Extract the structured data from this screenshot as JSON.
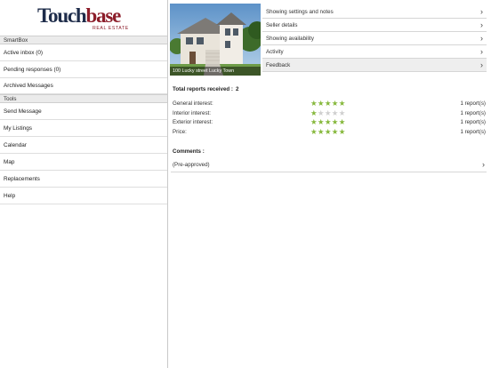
{
  "brand": {
    "logo_touch": "Touch",
    "logo_base": "base",
    "logo_sub": "REAL ESTATE"
  },
  "sidebar": {
    "sections": [
      {
        "header": "SmartBox",
        "items": [
          "Active inbox (0)",
          "Pending responses (0)",
          "Archived Messages"
        ]
      },
      {
        "header": "Tools",
        "items": [
          "Send Message",
          "My Listings",
          "Calendar",
          "Map",
          "Replacements",
          "Help"
        ]
      }
    ]
  },
  "listing": {
    "photo_caption": "100 Lucky street Lucky Town"
  },
  "menu": {
    "items": [
      "Showing settings and notes",
      "Seller details",
      "Showing availability",
      "Activity",
      "Feedback"
    ],
    "active": "Feedback"
  },
  "feedback": {
    "total_label": "Total reports received :",
    "total_count": "2",
    "ratings": [
      {
        "label": "General interest:",
        "stars": 5,
        "reports": "1 report(s)"
      },
      {
        "label": "Interior interest:",
        "stars": 1,
        "reports": "1 report(s)"
      },
      {
        "label": "Exterior interest:",
        "stars": 5,
        "reports": "1 report(s)"
      },
      {
        "label": "Price:",
        "stars": 5,
        "reports": "1 report(s)"
      }
    ],
    "max_stars": 5,
    "comments_label": "Comments :",
    "comments": [
      "(Pre-approved)"
    ]
  },
  "colors": {
    "star_on": "#86b83c",
    "star_off": "#cfcfcf",
    "brand_navy": "#1e2c4a",
    "brand_red": "#8c1d2a"
  },
  "icons": {
    "row_chevron": "chevron-right-icon",
    "star": "star-icon"
  }
}
